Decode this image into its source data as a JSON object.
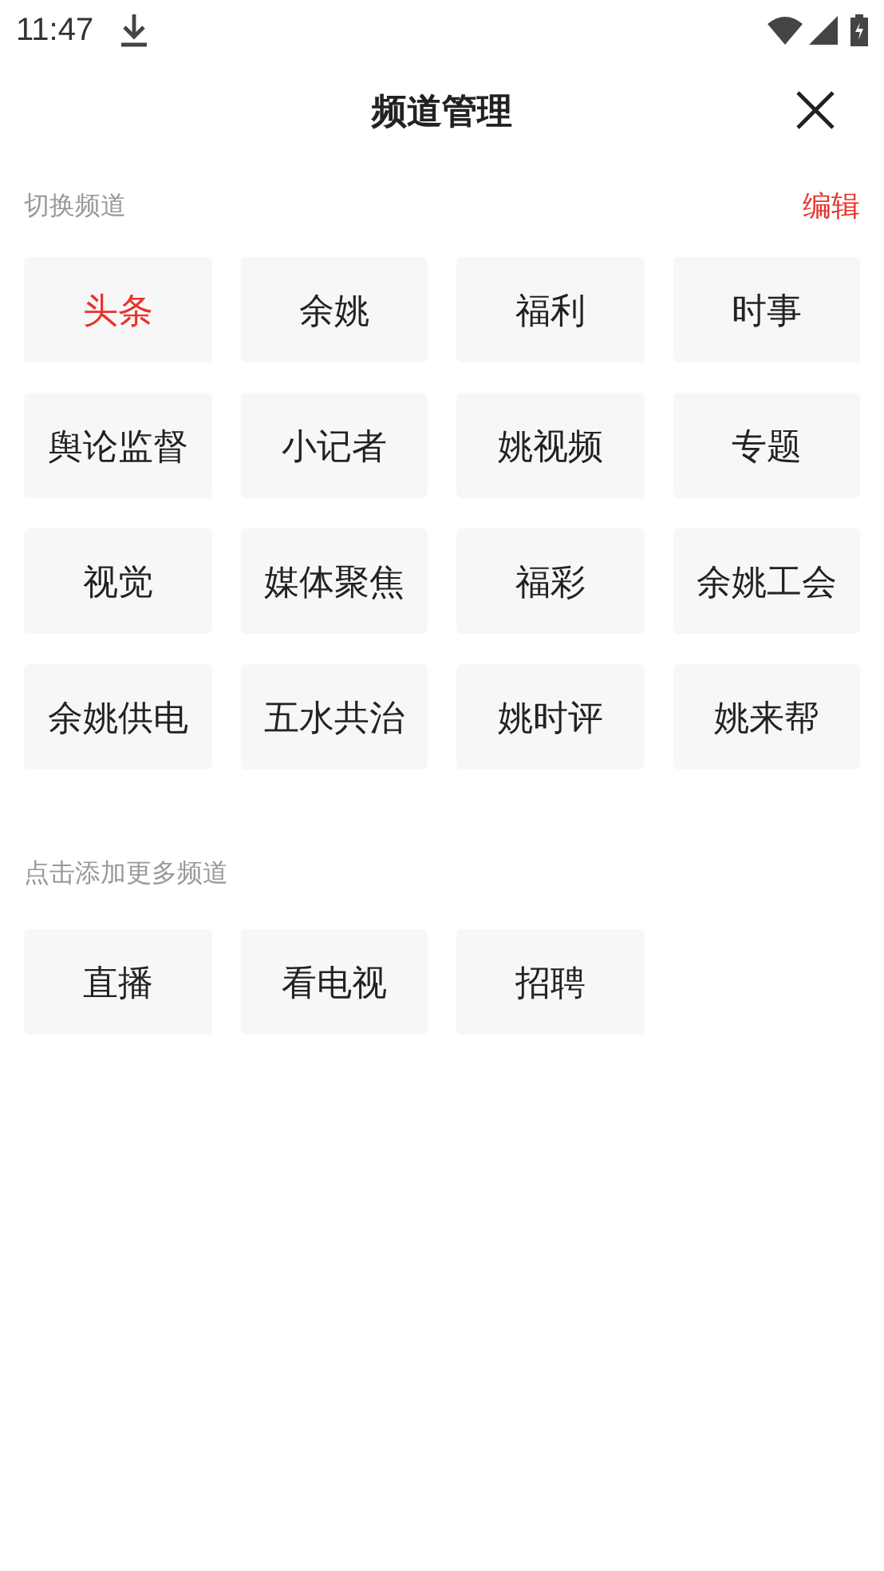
{
  "status_bar": {
    "time": "11:47"
  },
  "header": {
    "title": "频道管理"
  },
  "my_channels": {
    "label": "切换频道",
    "edit": "编辑",
    "items": [
      {
        "label": "头条",
        "selected": true
      },
      {
        "label": "余姚",
        "selected": false
      },
      {
        "label": "福利",
        "selected": false
      },
      {
        "label": "时事",
        "selected": false
      },
      {
        "label": "舆论监督",
        "selected": false
      },
      {
        "label": "小记者",
        "selected": false
      },
      {
        "label": "姚视频",
        "selected": false
      },
      {
        "label": "专题",
        "selected": false
      },
      {
        "label": "视觉",
        "selected": false
      },
      {
        "label": "媒体聚焦",
        "selected": false
      },
      {
        "label": "福彩",
        "selected": false
      },
      {
        "label": "余姚工会",
        "selected": false
      },
      {
        "label": "余姚供电",
        "selected": false
      },
      {
        "label": "五水共治",
        "selected": false
      },
      {
        "label": "姚时评",
        "selected": false
      },
      {
        "label": "姚来帮",
        "selected": false
      }
    ]
  },
  "more_channels": {
    "label": "点击添加更多频道",
    "items": [
      {
        "label": "直播"
      },
      {
        "label": "看电视"
      },
      {
        "label": "招聘"
      }
    ]
  }
}
